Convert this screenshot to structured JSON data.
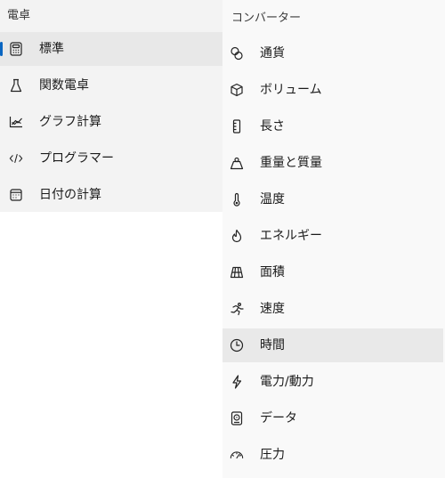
{
  "calculators": {
    "title": "電卓",
    "items": [
      {
        "label": "標準",
        "icon": "calculator-icon",
        "selected": true
      },
      {
        "label": "関数電卓",
        "icon": "flask-icon"
      },
      {
        "label": "グラフ計算",
        "icon": "graph-icon"
      },
      {
        "label": "プログラマー",
        "icon": "code-icon"
      },
      {
        "label": "日付の計算",
        "icon": "calendar-icon"
      }
    ]
  },
  "converters": {
    "title": "コンバーター",
    "items": [
      {
        "label": "通貨",
        "icon": "currency-icon"
      },
      {
        "label": "ボリューム",
        "icon": "cube-icon"
      },
      {
        "label": "長さ",
        "icon": "ruler-icon"
      },
      {
        "label": "重量と質量",
        "icon": "weight-icon"
      },
      {
        "label": "温度",
        "icon": "thermometer-icon"
      },
      {
        "label": "エネルギー",
        "icon": "fire-icon"
      },
      {
        "label": "面積",
        "icon": "area-grid-icon"
      },
      {
        "label": "速度",
        "icon": "running-icon"
      },
      {
        "label": "時間",
        "icon": "clock-icon",
        "hovered": true
      },
      {
        "label": "電力/動力",
        "icon": "lightning-icon"
      },
      {
        "label": "データ",
        "icon": "storage-icon"
      },
      {
        "label": "圧力",
        "icon": "gauge-icon"
      }
    ]
  },
  "colors": {
    "accent": "#0a66c2",
    "left_bg": "#f3f3f3",
    "right_bg": "#f9f9f9",
    "selected_bg": "#e8e8e8",
    "hover_bg": "#e9e9e9"
  }
}
